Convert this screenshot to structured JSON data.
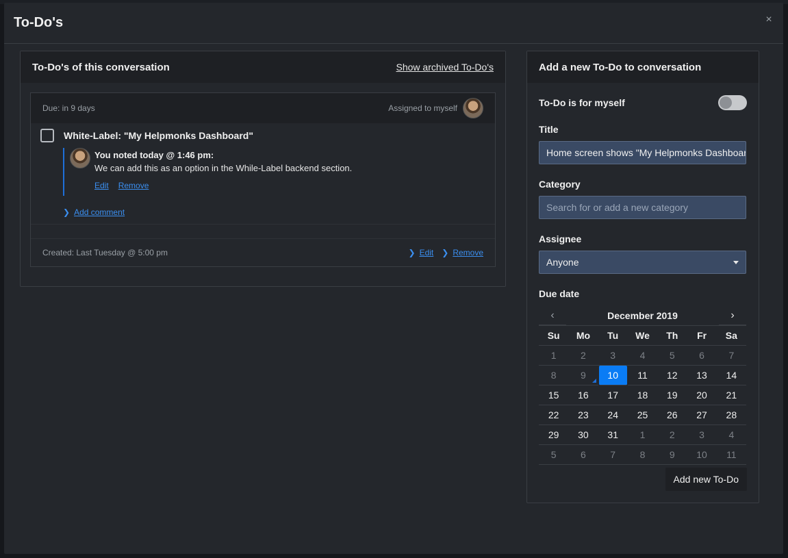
{
  "modal": {
    "title": "To-Do's",
    "close_glyph": "×"
  },
  "left_panel": {
    "title": "To-Do's of this conversation",
    "show_archived": "Show archived To-Do's",
    "todo": {
      "due": "Due: in 9 days",
      "assigned": "Assigned to myself",
      "title": "White-Label: \"My Helpmonks Dashboard\"",
      "note": {
        "header": "You noted today @ 1:46 pm:",
        "text": "We can add this as an option in the While-Label backend section.",
        "edit": "Edit",
        "remove": "Remove"
      },
      "add_comment": "Add comment",
      "created": "Created: Last Tuesday @ 5:00 pm",
      "edit": "Edit",
      "remove": "Remove"
    }
  },
  "right_panel": {
    "title": "Add a new To-Do to conversation",
    "myself_label": "To-Do is for myself",
    "myself_on": false,
    "title_label": "Title",
    "title_value": "Home screen shows \"My Helpmonks Dashboard\"",
    "category_label": "Category",
    "category_placeholder": "Search for or add a new category",
    "assignee_label": "Assignee",
    "assignee_value": "Anyone",
    "due_label": "Due date",
    "calendar": {
      "month": "December 2019",
      "prev_glyph": "‹",
      "next_glyph": "›",
      "weekdays": [
        "Su",
        "Mo",
        "Tu",
        "We",
        "Th",
        "Fr",
        "Sa"
      ],
      "selected": 10,
      "today": 9,
      "weeks": [
        [
          {
            "d": 1,
            "o": true
          },
          {
            "d": 2,
            "o": true
          },
          {
            "d": 3,
            "o": true
          },
          {
            "d": 4,
            "o": true
          },
          {
            "d": 5,
            "o": true
          },
          {
            "d": 6,
            "o": true
          },
          {
            "d": 7,
            "o": true
          }
        ],
        [
          {
            "d": 8,
            "o": true
          },
          {
            "d": 9,
            "o": true
          },
          {
            "d": 10,
            "o": false
          },
          {
            "d": 11,
            "o": false
          },
          {
            "d": 12,
            "o": false
          },
          {
            "d": 13,
            "o": false
          },
          {
            "d": 14,
            "o": false
          }
        ],
        [
          {
            "d": 15,
            "o": false
          },
          {
            "d": 16,
            "o": false
          },
          {
            "d": 17,
            "o": false
          },
          {
            "d": 18,
            "o": false
          },
          {
            "d": 19,
            "o": false
          },
          {
            "d": 20,
            "o": false
          },
          {
            "d": 21,
            "o": false
          }
        ],
        [
          {
            "d": 22,
            "o": false
          },
          {
            "d": 23,
            "o": false
          },
          {
            "d": 24,
            "o": false
          },
          {
            "d": 25,
            "o": false
          },
          {
            "d": 26,
            "o": false
          },
          {
            "d": 27,
            "o": false
          },
          {
            "d": 28,
            "o": false
          }
        ],
        [
          {
            "d": 29,
            "o": false
          },
          {
            "d": 30,
            "o": false
          },
          {
            "d": 31,
            "o": false
          },
          {
            "d": 1,
            "o": true
          },
          {
            "d": 2,
            "o": true
          },
          {
            "d": 3,
            "o": true
          },
          {
            "d": 4,
            "o": true
          }
        ],
        [
          {
            "d": 5,
            "o": true
          },
          {
            "d": 6,
            "o": true
          },
          {
            "d": 7,
            "o": true
          },
          {
            "d": 8,
            "o": true
          },
          {
            "d": 9,
            "o": true
          },
          {
            "d": 10,
            "o": true
          },
          {
            "d": 11,
            "o": true
          }
        ]
      ]
    },
    "submit": "Add new To-Do"
  }
}
